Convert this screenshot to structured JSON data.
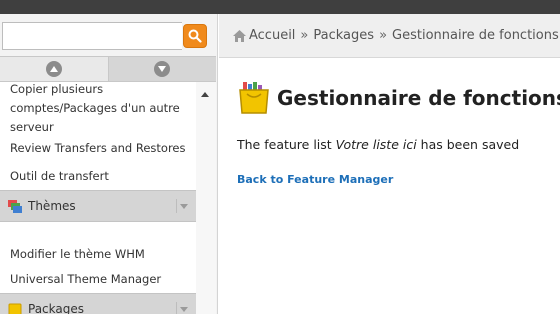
{
  "search": {
    "value": "",
    "placeholder": ""
  },
  "sidebar": {
    "scroll_up_label": "",
    "items": [
      {
        "label": "Copier plusieurs comptes/Packages d'un autre serveur"
      },
      {
        "label": "Review Transfers and Restores"
      },
      {
        "label": "Outil de transfert"
      }
    ],
    "sections": [
      {
        "label": "Thèmes",
        "icon": "themes-icon"
      },
      {
        "label": "Packages",
        "icon": "packages-icon"
      }
    ],
    "theme_items": [
      {
        "label": "Modifier le thème WHM"
      },
      {
        "label": "Universal Theme Manager"
      }
    ]
  },
  "breadcrumb": {
    "home": "Accueil",
    "separator": "»",
    "packages": "Packages",
    "current": "Gestionnaire de fonctions"
  },
  "main": {
    "title": "Gestionnaire de fonctions",
    "message_prefix": "The feature list",
    "message_name": "Votre liste ici",
    "message_suffix": "has been saved",
    "back_link": "Back to Feature Manager"
  },
  "colors": {
    "accent": "#f08a1c",
    "link": "#1d6fb8",
    "topbar": "#3f3f3f",
    "section_bg": "#d5d5d5"
  }
}
